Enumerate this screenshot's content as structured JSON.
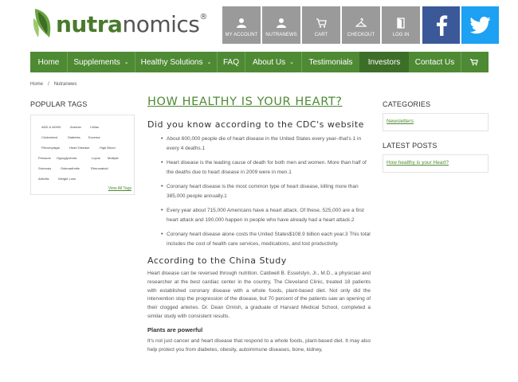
{
  "brand": {
    "name_bold": "nutra",
    "name_rest": "nomics",
    "mark": "®",
    "color": "#4e8a33"
  },
  "top_buttons": [
    {
      "label": "MY ACCOUNT",
      "icon": "user-icon"
    },
    {
      "label": "NUTRANEWS",
      "icon": "user-icon"
    },
    {
      "label": "CART",
      "icon": "cart-icon"
    },
    {
      "label": "CHECKOUT",
      "icon": "hanger-icon"
    },
    {
      "label": "LOG IN",
      "icon": "door-icon"
    }
  ],
  "social": [
    {
      "name": "facebook",
      "icon": "facebook-icon",
      "color": "#3b5998"
    },
    {
      "name": "twitter",
      "icon": "twitter-icon",
      "color": "#1da1f2"
    }
  ],
  "nav": {
    "items": [
      {
        "label": "Home",
        "dropdown": false
      },
      {
        "label": "Supplements",
        "dropdown": true
      },
      {
        "label": "Healthy Solutions",
        "dropdown": true
      },
      {
        "label": "FAQ",
        "dropdown": false
      },
      {
        "label": "About Us",
        "dropdown": true
      },
      {
        "label": "Testimonials",
        "dropdown": false
      },
      {
        "label": "Investors",
        "dropdown": false,
        "active": true
      },
      {
        "label": "Contact Us",
        "dropdown": false
      }
    ],
    "cart_icon": "cart-icon",
    "caret": "⌄"
  },
  "breadcrumb": {
    "home": "Home",
    "sep": "/",
    "current": "Nutranews"
  },
  "sidebar_left": {
    "title": "POPULAR TAGS",
    "tags": [
      "ADD & ADHD",
      "Anemia",
      "Celiac",
      "Cholesterol",
      "Diabetes",
      "Eczema",
      "Fibromyalgia",
      "Heart Disease",
      "High Blood",
      "Pressure",
      "Hypoglycemia",
      "Lupus",
      "Multiple",
      "Sclerosis",
      "Osteoarthritis",
      "Rheumatoid",
      "Arthritis",
      "Weight Loss"
    ],
    "view_all": "View All Tags"
  },
  "article": {
    "title": "HOW HEALTHY IS YOUR HEART?",
    "h2": "Did you know according to the CDC's website",
    "bullets": [
      "About 600,000 people die of heart disease in the United States every year–that's 1 in every 4 deaths.1",
      "Heart disease is the leading cause of death for both men and women. More than half of the deaths due to heart disease in 2009 were in men.1",
      "Coronary heart disease is the most common type of heart disease, killing more than 385,000 people annually.1",
      "Every year about 715,000 Americans have a heart attack. Of these, 525,000 are a first heart attack and 190,000 happen in people who have already had a heart attack.2",
      "Coronary heart disease alone costs the United States$108.9 billion each year.3 This total includes the cost of health care services, medications, and lost productivity."
    ],
    "h3": "According to the China Study",
    "para1": "Heart disease can be reversed through nutrition. Caldwell B. Esselstyn, Jr., M.D., a physician and researcher at the best cardiac center in the country, The Cleveland Clinic, treated 18 patients with established coronary disease with a whole foods, plant-based diet. Not only did the intervention stop the progression of the disease, but 70 percent of the patients saw an opening of their clogged arteries. Dr. Dean Ornish, a graduate of Harvard Medical School, completed a similar study with consistent results.",
    "sub": "Plants are powerful",
    "para2": "It's not just cancer and heart disease that respond to a whole foods, plant-based diet. It may also help protect you from diabetes, obesity, autoimmune diseases, bone, kidney,"
  },
  "sidebar_right": {
    "categories_title": "CATEGORIES",
    "categories": [
      "Newsletters"
    ],
    "latest_title": "LATEST POSTS",
    "latest": [
      "How healthy is your Heart?"
    ]
  }
}
